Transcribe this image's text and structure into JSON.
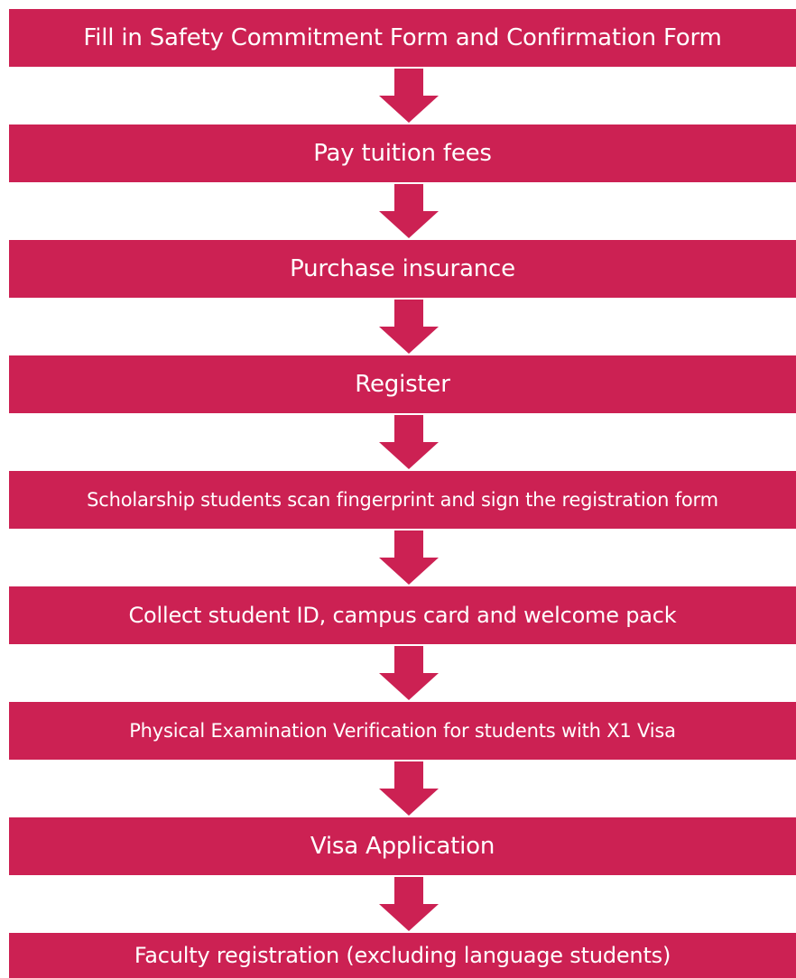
{
  "flowchart": {
    "steps": [
      {
        "label": "Fill in Safety Commitment Form and Confirmation Form"
      },
      {
        "label": "Pay tuition fees"
      },
      {
        "label": "Purchase insurance"
      },
      {
        "label": "Register"
      },
      {
        "label": "Scholarship students scan fingerprint and sign the registration form"
      },
      {
        "label": "Collect student ID, campus card and welcome pack"
      },
      {
        "label": "Physical Examination Verification for students with X1 Visa"
      },
      {
        "label": "Visa Application"
      },
      {
        "label": "Faculty registration (excluding language students)"
      }
    ],
    "colors": {
      "box": "#cc2153",
      "arrow": "#cc2153",
      "text": "#ffffff",
      "background": "#ffffff"
    },
    "arrow_icon": "down-arrow-icon"
  }
}
